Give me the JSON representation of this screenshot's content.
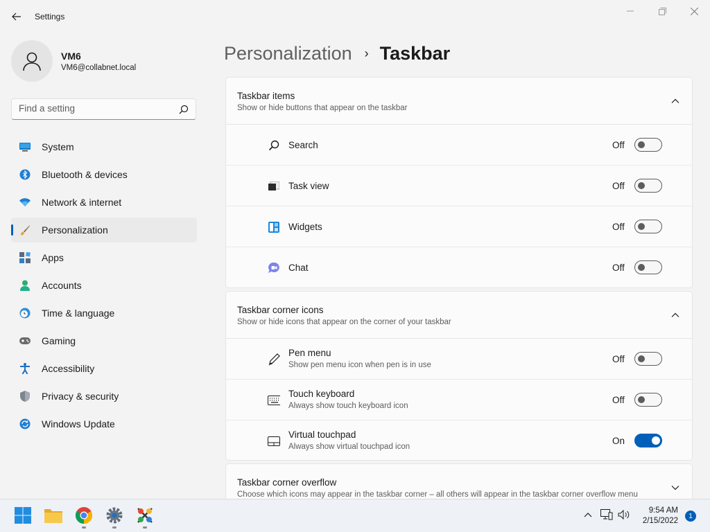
{
  "window": {
    "title": "Settings"
  },
  "user": {
    "name": "VM6",
    "email": "VM6@collabnet.local"
  },
  "search": {
    "placeholder": "Find a setting"
  },
  "nav": [
    {
      "label": "System",
      "icon": "monitor-icon"
    },
    {
      "label": "Bluetooth & devices",
      "icon": "bluetooth-icon"
    },
    {
      "label": "Network & internet",
      "icon": "wifi-icon"
    },
    {
      "label": "Personalization",
      "icon": "brush-icon",
      "active": true
    },
    {
      "label": "Apps",
      "icon": "apps-icon"
    },
    {
      "label": "Accounts",
      "icon": "person-icon"
    },
    {
      "label": "Time & language",
      "icon": "globe-clock-icon"
    },
    {
      "label": "Gaming",
      "icon": "gamepad-icon"
    },
    {
      "label": "Accessibility",
      "icon": "accessibility-icon"
    },
    {
      "label": "Privacy & security",
      "icon": "shield-icon"
    },
    {
      "label": "Windows Update",
      "icon": "update-icon"
    }
  ],
  "breadcrumb": {
    "parent": "Personalization",
    "separator": "›",
    "current": "Taskbar"
  },
  "taskbar_items": {
    "title": "Taskbar items",
    "description": "Show or hide buttons that appear on the taskbar",
    "rows": [
      {
        "label": "Search",
        "state": "Off",
        "on": false,
        "icon": "search-icon"
      },
      {
        "label": "Task view",
        "state": "Off",
        "on": false,
        "icon": "task-view-icon"
      },
      {
        "label": "Widgets",
        "state": "Off",
        "on": false,
        "icon": "widgets-icon"
      },
      {
        "label": "Chat",
        "state": "Off",
        "on": false,
        "icon": "chat-icon"
      }
    ]
  },
  "corner_icons": {
    "title": "Taskbar corner icons",
    "description": "Show or hide icons that appear on the corner of your taskbar",
    "rows": [
      {
        "label": "Pen menu",
        "sub": "Show pen menu icon when pen is in use",
        "state": "Off",
        "on": false,
        "icon": "pen-icon"
      },
      {
        "label": "Touch keyboard",
        "sub": "Always show touch keyboard icon",
        "state": "Off",
        "on": false,
        "icon": "keyboard-icon"
      },
      {
        "label": "Virtual touchpad",
        "sub": "Always show virtual touchpad icon",
        "state": "On",
        "on": true,
        "icon": "touchpad-icon"
      }
    ]
  },
  "corner_overflow": {
    "title": "Taskbar corner overflow",
    "description": "Choose which icons may appear in the taskbar corner – all others will appear in the taskbar corner overflow menu"
  },
  "taskbar": {
    "apps": [
      "start-icon",
      "file-explorer-icon",
      "chrome-icon",
      "settings-icon",
      "app-icon"
    ],
    "time": "9:54 AM",
    "date": "2/15/2022",
    "notification_count": "1"
  },
  "colors": {
    "accent": "#005fb8",
    "background": "#f3f3f3",
    "card": "#fbfbfb"
  }
}
